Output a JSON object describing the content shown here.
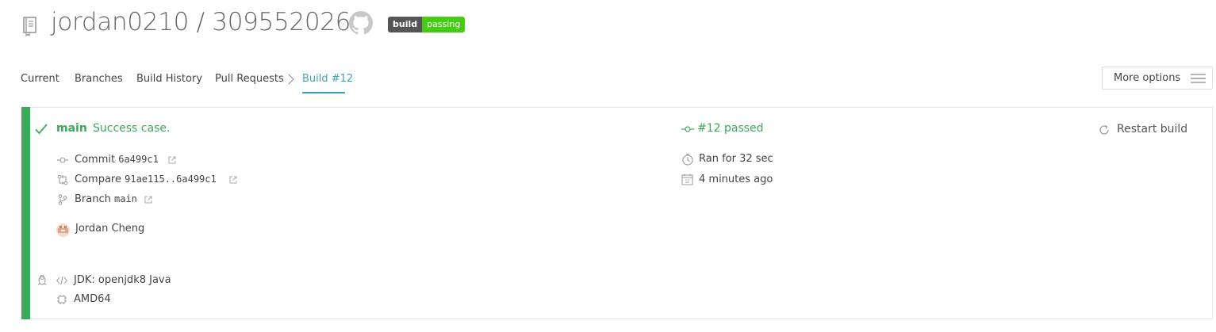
{
  "header": {
    "owner": "jordan0210",
    "separator": "/",
    "repo": "309552026",
    "badge": {
      "left": "build",
      "right": "passing",
      "left_color": "#555555",
      "right_color": "#44cc11"
    },
    "icons": [
      "repo-book-icon",
      "github-icon"
    ]
  },
  "tabs": [
    {
      "label": "Current"
    },
    {
      "label": "Branches"
    },
    {
      "label": "Build History"
    },
    {
      "label": "Pull Requests"
    },
    {
      "label": "Build #12",
      "active": true
    }
  ],
  "more_options": {
    "label": "More options"
  },
  "build": {
    "branch": "main",
    "message": "Success case.",
    "status": "#12 passed",
    "restart_label": "Restart build",
    "commit_label": "Commit",
    "commit_hash": "6a499c1",
    "compare_label": "Compare",
    "compare_range": "91ae115..6a499c1",
    "branch_label": "Branch",
    "branch_value": "main",
    "author": "Jordan Cheng",
    "duration": "Ran for 32 sec",
    "finished": "4 minutes ago",
    "jdk": "JDK: openjdk8 Java",
    "arch": "AMD64",
    "status_color": "#39aa56"
  },
  "colors": {
    "accent": "#3aa6b5",
    "success": "#39aa56"
  }
}
